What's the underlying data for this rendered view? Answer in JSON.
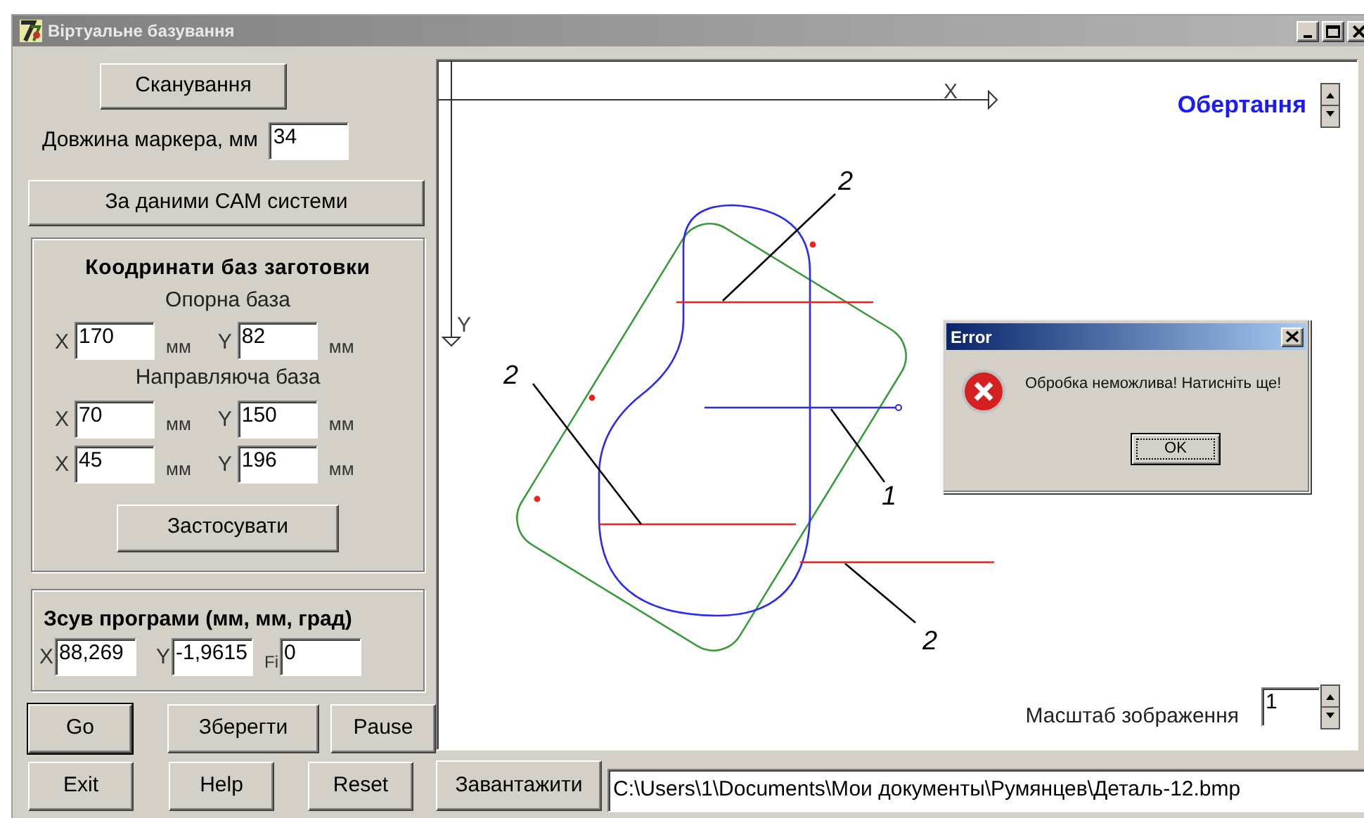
{
  "window": {
    "title": "Віртуальне базування"
  },
  "scan_button": "Сканування",
  "marker_length": {
    "label": "Довжина маркера, мм",
    "value": "34"
  },
  "cam_button": "За даними САМ системи",
  "base_coords": {
    "title": "Коодринати  баз заготовки",
    "sections": [
      {
        "label": "Опорна база",
        "rows": [
          [
            {
              "axis": "X",
              "value": "170",
              "unit": "мм"
            },
            {
              "axis": "Y",
              "value": "82",
              "unit": "мм"
            }
          ]
        ]
      },
      {
        "label": "Направляюча база",
        "rows": [
          [
            {
              "axis": "X",
              "value": "70",
              "unit": "мм"
            },
            {
              "axis": "Y",
              "value": "150",
              "unit": "мм"
            }
          ],
          [
            {
              "axis": "X",
              "value": "45",
              "unit": "мм"
            },
            {
              "axis": "Y",
              "value": "196",
              "unit": "мм"
            }
          ]
        ]
      }
    ],
    "apply_button": "Застосувати"
  },
  "program_shift": {
    "title": "Зсув програми (мм, мм, град)",
    "fields": [
      {
        "axis": "X",
        "value": "88,269"
      },
      {
        "axis": "Y",
        "value": "-1,9615"
      },
      {
        "axis": "Fi",
        "value": "0"
      }
    ]
  },
  "buttons": [
    [
      {
        "label": "Go",
        "focused": true
      },
      {
        "label": "Зберегти",
        "focused": false
      },
      {
        "label": "Pause",
        "focused": false
      }
    ],
    [
      {
        "label": "Exit",
        "focused": false
      },
      {
        "label": "Help",
        "focused": false
      },
      {
        "label": "Reset",
        "focused": false
      }
    ]
  ],
  "canvas": {
    "x_axis": "X",
    "y_axis": "Y",
    "rotation_label": "Обертання",
    "callouts": [
      "2",
      "2",
      "1",
      "2"
    ],
    "scale": {
      "label": "Масштаб зображення",
      "value": "1"
    }
  },
  "load_button": "Завантажити",
  "file_path": "C:\\Users\\1\\Documents\\Мои документы\\Румянцев\\Деталь-12.bmp",
  "dialog": {
    "title": "Error",
    "message": "Обробка неможлива! Натисніть ще!",
    "ok_button": "OK"
  }
}
